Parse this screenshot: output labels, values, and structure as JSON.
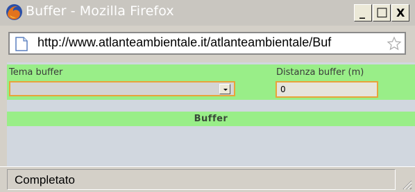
{
  "window": {
    "title": "Buffer - Mozilla Firefox",
    "minimize_symbol": "_",
    "maximize_symbol": "□",
    "close_symbol": "X",
    "app_icon": "firefox-icon"
  },
  "address_bar": {
    "url": "http://www.atlanteambientale.it/atlanteambientale/Buf",
    "page_icon": "page-icon",
    "bookmark_icon": "star-icon"
  },
  "form": {
    "tema_buffer_label": "Tema buffer",
    "tema_buffer_value": "",
    "distanza_label": "Distanza buffer (m)",
    "distanza_value": "0",
    "submit_label": "Buffer"
  },
  "status_bar": {
    "text": "Completato"
  },
  "colors": {
    "band_green": "#99ee88",
    "field_border": "#e8a33a",
    "content_bg": "#d1d7df"
  }
}
